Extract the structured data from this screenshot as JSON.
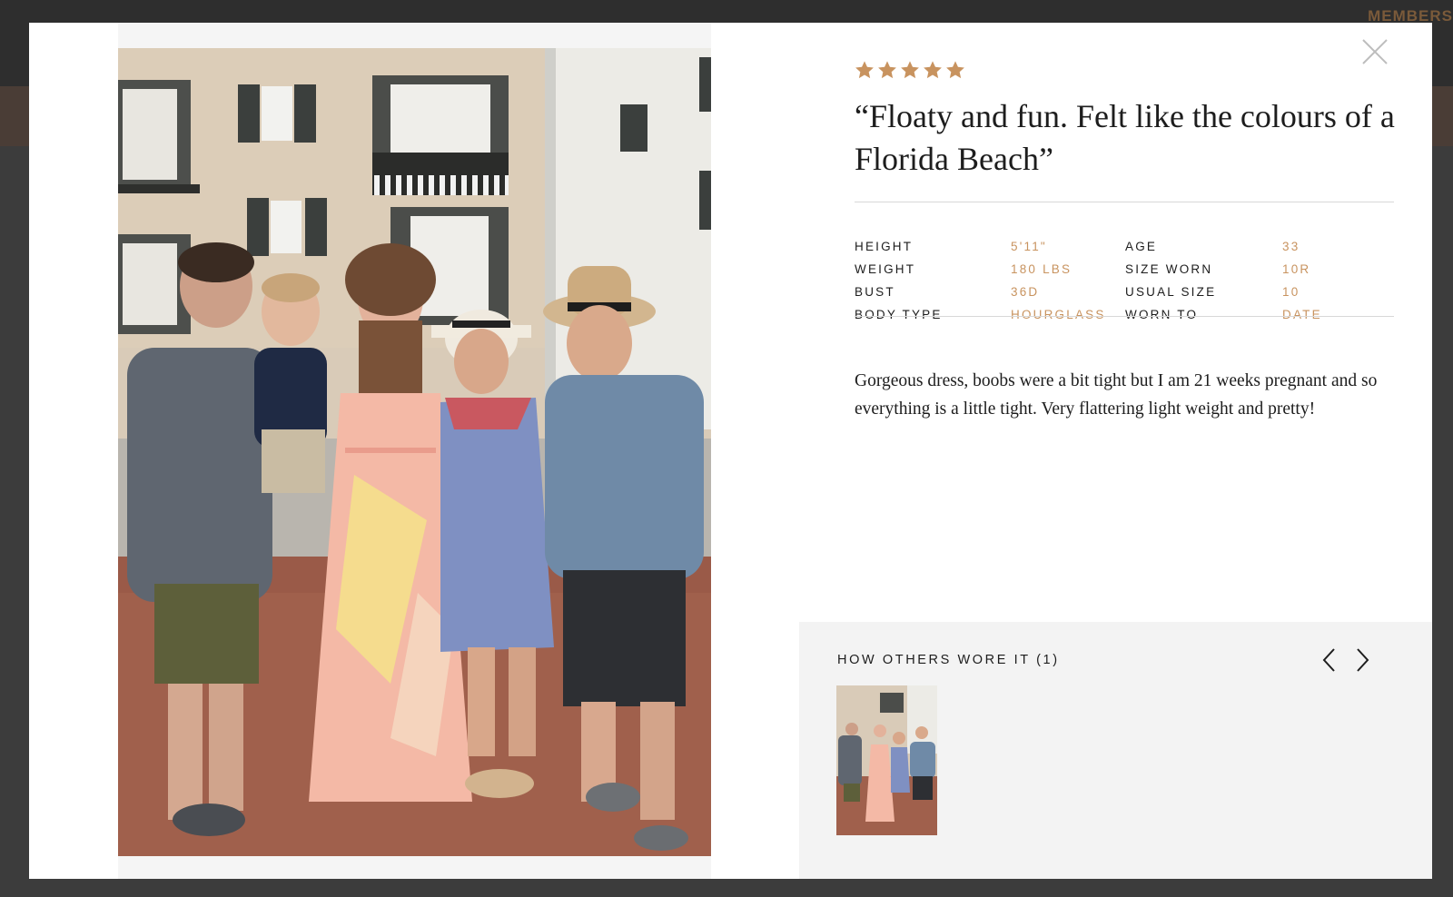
{
  "background": {
    "member_text": "MEMBERS"
  },
  "modal": {
    "rating": 5,
    "review_title": "“Floaty and fun. Felt like the colours of a Florida Beach”",
    "stats": [
      {
        "label_1": "HEIGHT",
        "value_1": "5'11\"",
        "label_2": "AGE",
        "value_2": "33"
      },
      {
        "label_1": "WEIGHT",
        "value_1": "180 LBS",
        "label_2": "SIZE WORN",
        "value_2": "10R"
      },
      {
        "label_1": "BUST",
        "value_1": "36D",
        "label_2": "USUAL SIZE",
        "value_2": "10"
      },
      {
        "label_1": "BODY TYPE",
        "value_1": "HOURGLASS",
        "label_2": "WORN TO",
        "value_2": "DATE"
      }
    ],
    "review_body": "Gorgeous dress, boobs were a bit tight but I am 21 weeks pregnant and so everything is a little tight. Very flattering light weight and pretty!",
    "others": {
      "title": "HOW OTHERS WORE IT (1)"
    }
  },
  "colors": {
    "accent": "#c8935f",
    "star": "#c8935f",
    "text": "#1d1d1d",
    "others_bg": "#f3f3f3"
  },
  "icons": {
    "close": "close-icon",
    "prev": "chevron-left-icon",
    "next": "chevron-right-icon",
    "star": "star-icon"
  }
}
